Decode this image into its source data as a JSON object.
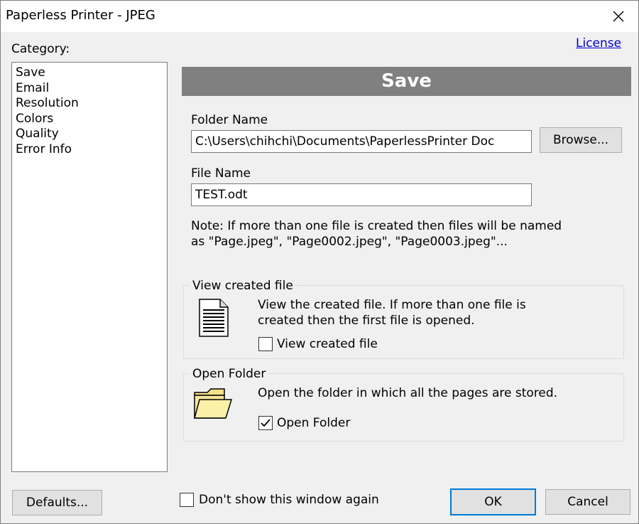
{
  "window": {
    "title": "Paperless Printer - JPEG"
  },
  "sidebar": {
    "label": "Category:",
    "items": [
      {
        "label": "Save"
      },
      {
        "label": "Email"
      },
      {
        "label": "Resolution"
      },
      {
        "label": "Colors"
      },
      {
        "label": "Quality"
      },
      {
        "label": "Error Info"
      }
    ]
  },
  "license_link": "License",
  "panel": {
    "header": "Save",
    "folder_label": "Folder Name",
    "folder_value": "C:\\Users\\chihchi\\Documents\\PaperlessPrinter Doc",
    "browse_label": "Browse...",
    "file_label": "File Name",
    "file_value": "TEST.odt",
    "note_line1": "Note: If more than one file is created then files will be named",
    "note_line2": "as \"Page.jpeg\", \"Page0002.jpeg\", \"Page0003.jpeg\"..."
  },
  "view_group": {
    "title": "View created file",
    "desc_line1": "View the created file. If more than one file is",
    "desc_line2": "created then the first file is opened.",
    "checkbox_label": "View created file",
    "checked": false
  },
  "folder_group": {
    "title": "Open Folder",
    "desc": "Open the folder in which all the pages are stored.",
    "checkbox_label": "Open Folder",
    "checked": true
  },
  "footer": {
    "defaults_label": "Defaults...",
    "dont_show_label": "Don't show this window again",
    "ok_label": "OK",
    "cancel_label": "Cancel"
  }
}
